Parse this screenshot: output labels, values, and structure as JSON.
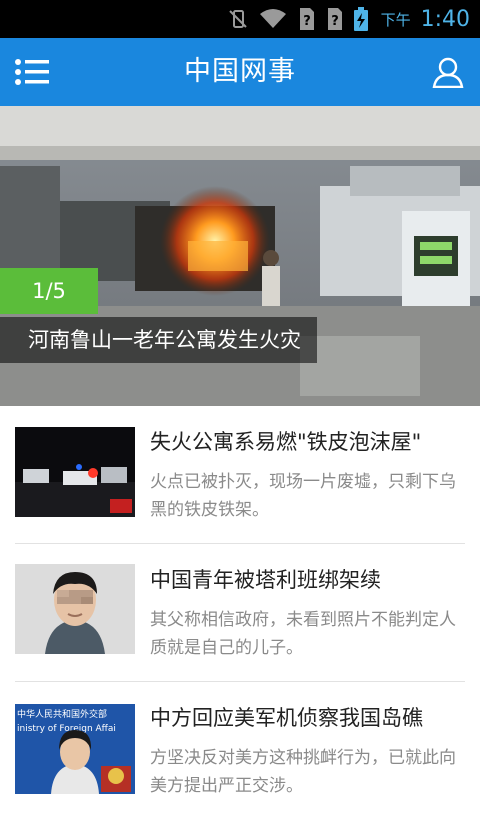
{
  "status_bar": {
    "period": "下午",
    "time": "1:40",
    "icons": [
      "vibrate-off-icon",
      "wifi-icon",
      "no-sim-icon",
      "no-sim-icon",
      "battery-charging-icon"
    ]
  },
  "app_bar": {
    "title": "中国网事",
    "menu_icon": "menu-icon",
    "profile_icon": "user-icon",
    "background": "#1a87de"
  },
  "hero": {
    "counter": "1/5",
    "caption": "河南鲁山一老年公寓发生火灾",
    "counter_color": "#5bbd3a"
  },
  "news": [
    {
      "title": "失火公寓系易燃\"铁皮泡沫屋\"",
      "summary": "火点已被扑灭，现场一片废墟，只剩下乌黑的铁皮铁架。"
    },
    {
      "title": "中国青年被塔利班绑架续",
      "summary": "其父称相信政府，未看到照片不能判定人质就是自己的儿子。"
    },
    {
      "title": "中方回应美军机侦察我国岛礁",
      "summary": "方坚决反对美方这种挑衅行为，已就此向美方提出严正交涉。",
      "thumb_text": "中华人民共和国外交部 inistry of Foreign Affai"
    }
  ]
}
